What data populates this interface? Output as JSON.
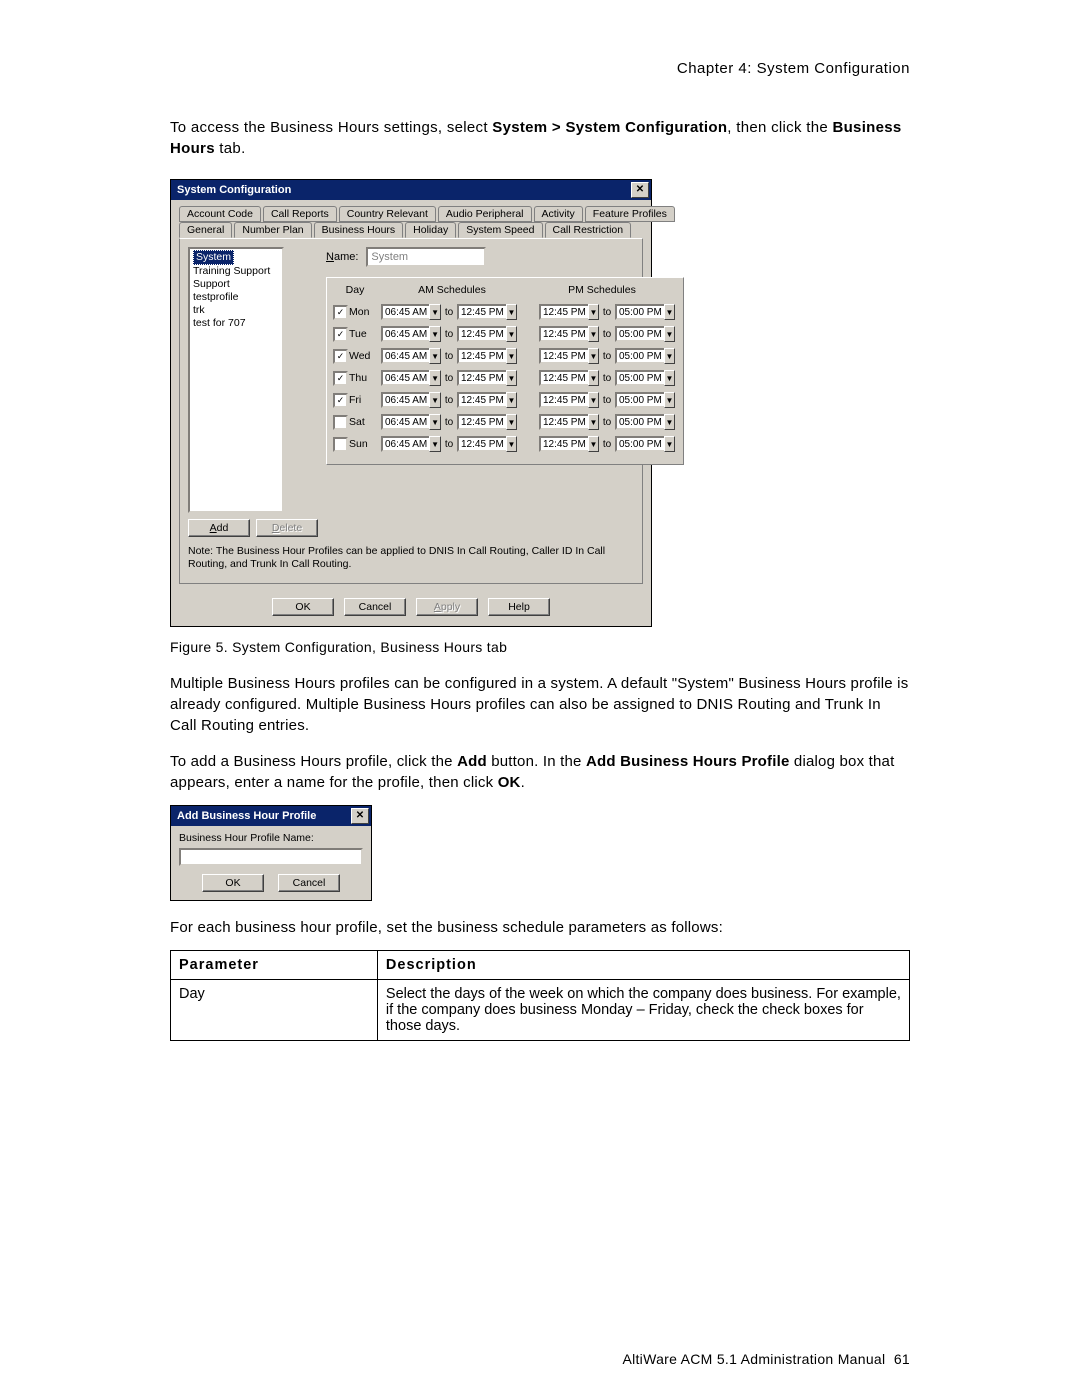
{
  "header": {
    "chapter": "Chapter 4:  System Configuration"
  },
  "intro": {
    "pre": "To access the Business Hours settings, select ",
    "bold1": "System > System Configuration",
    "mid": ", then click the ",
    "bold2": "Business Hours",
    "post": " tab."
  },
  "dialog": {
    "title": "System Configuration",
    "close_glyph": "✕",
    "tabs_back": [
      "Account Code",
      "Call Reports",
      "Country Relevant",
      "Audio Peripheral",
      "Activity",
      "Feature Profiles"
    ],
    "tabs_front": [
      "General",
      "Number Plan",
      "Business Hours",
      "Holiday",
      "System Speed",
      "Call Restriction"
    ],
    "active_tab": "Business Hours",
    "name_label_ul": "N",
    "name_label_rest": "ame:",
    "name_value": "System",
    "profiles": [
      "System",
      "Training Support",
      "Support",
      "testprofile",
      "trk",
      "test for 707"
    ],
    "selected_profile": "System",
    "add_label": "Add",
    "add_ul": "A",
    "delete_label": "Delete",
    "delete_ul": "D",
    "col_day": "Day",
    "col_am": "AM Schedules",
    "col_pm": "PM Schedules",
    "to_label": "to",
    "days": [
      {
        "abbr": "Mon",
        "checked": true,
        "am_start": "06:45 AM",
        "am_end": "12:45 PM",
        "pm_start": "12:45 PM",
        "pm_end": "05:00 PM"
      },
      {
        "abbr": "Tue",
        "checked": true,
        "am_start": "06:45 AM",
        "am_end": "12:45 PM",
        "pm_start": "12:45 PM",
        "pm_end": "05:00 PM"
      },
      {
        "abbr": "Wed",
        "checked": true,
        "am_start": "06:45 AM",
        "am_end": "12:45 PM",
        "pm_start": "12:45 PM",
        "pm_end": "05:00 PM"
      },
      {
        "abbr": "Thu",
        "checked": true,
        "am_start": "06:45 AM",
        "am_end": "12:45 PM",
        "pm_start": "12:45 PM",
        "pm_end": "05:00 PM"
      },
      {
        "abbr": "Fri",
        "checked": true,
        "am_start": "06:45 AM",
        "am_end": "12:45 PM",
        "pm_start": "12:45 PM",
        "pm_end": "05:00 PM"
      },
      {
        "abbr": "Sat",
        "checked": false,
        "am_start": "06:45 AM",
        "am_end": "12:45 PM",
        "pm_start": "12:45 PM",
        "pm_end": "05:00 PM"
      },
      {
        "abbr": "Sun",
        "checked": false,
        "am_start": "06:45 AM",
        "am_end": "12:45 PM",
        "pm_start": "12:45 PM",
        "pm_end": "05:00 PM"
      }
    ],
    "note": "Note: The Business Hour Profiles can be applied to DNIS In Call Routing, Caller ID In Call Routing, and Trunk In Call Routing.",
    "ok": "OK",
    "cancel": "Cancel",
    "apply": "Apply",
    "apply_ul": "A",
    "help": "Help"
  },
  "figure": {
    "caption": "Figure 5.   System Configuration, Business Hours tab"
  },
  "para2": "Multiple Business Hours profiles can be configured in a system. A default \"System\" Business Hours profile is already configured. Multiple Business Hours profiles can also be assigned to DNIS Routing and Trunk In Call Routing entries.",
  "para3": {
    "pre": "To add a Business Hours profile, click the ",
    "b1": "Add",
    "mid1": " button. In the ",
    "b2": "Add Business Hours Profile",
    "mid2": " dialog box that appears, enter a name for the profile, then click ",
    "b3": "OK",
    "post": "."
  },
  "small_dialog": {
    "title": "Add Business Hour Profile",
    "close_glyph": "✕",
    "label": "Business Hour Profile Name:",
    "ok": "OK",
    "cancel": "Cancel"
  },
  "para4": "For each business hour profile, set the business schedule parameters as follows:",
  "table": {
    "h1": "Parameter",
    "h2": "Description",
    "r1c1": "Day",
    "r1c2": "Select the days of the week on which the company does business. For example, if the company does business Monday – Friday, check the check boxes for those days."
  },
  "footer": {
    "text": "AltiWare ACM 5.1 Administration Manual",
    "page": "61"
  }
}
